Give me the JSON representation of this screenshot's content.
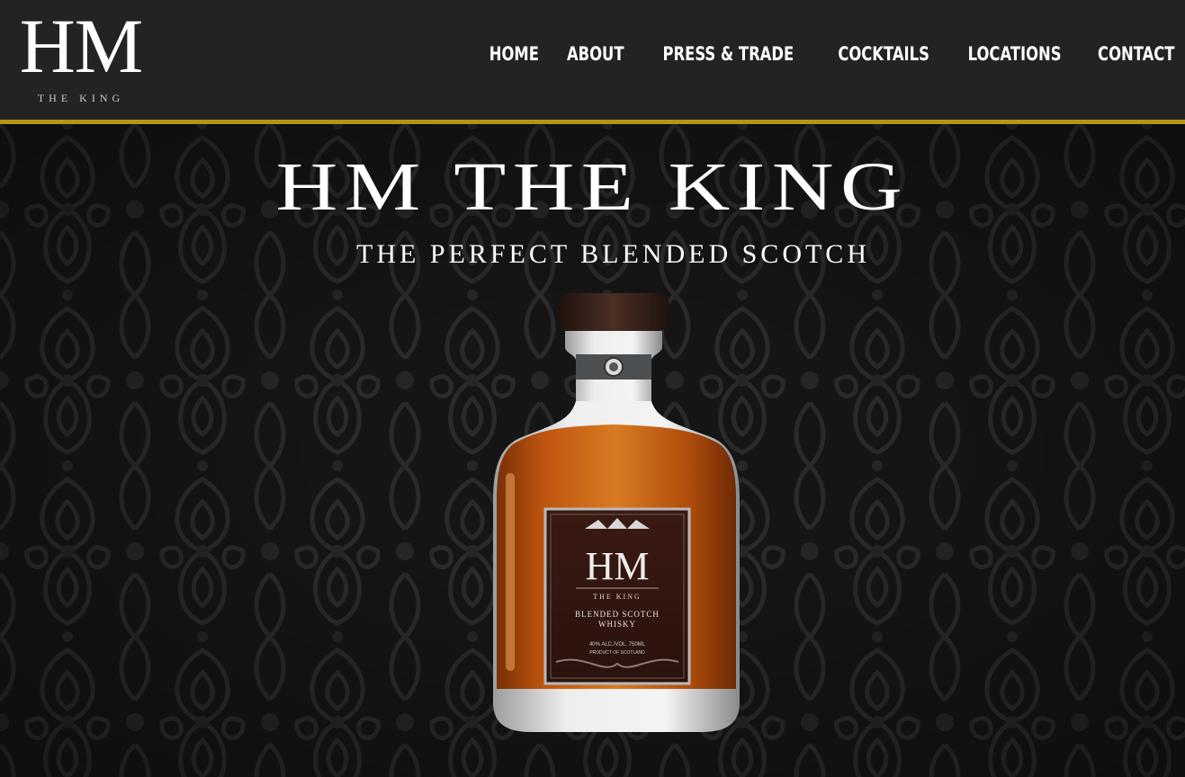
{
  "header": {
    "logo": {
      "mark": "HM",
      "subtitle": "THE KING"
    },
    "nav": [
      {
        "label": "HOME"
      },
      {
        "label": "ABOUT"
      },
      {
        "label": "PRESS & TRADE"
      },
      {
        "label": "COCKTAILS"
      },
      {
        "label": "LOCATIONS"
      },
      {
        "label": "CONTACT"
      }
    ]
  },
  "hero": {
    "title": "HM THE KING",
    "subtitle": "THE PERFECT BLENDED SCOTCH",
    "bottle_label": {
      "mark": "HM",
      "subtitle": "THE KING",
      "product": "BLENDED SCOTCH",
      "product_line2": "WHISKY",
      "abv": "40% ALC./VOL. 750ML",
      "origin": "PRODUCT OF SCOTLAND"
    }
  },
  "colors": {
    "header_bg": "#232323",
    "accent_gold": "#b3951b",
    "hero_bg": "#141414",
    "text": "#ffffff"
  }
}
